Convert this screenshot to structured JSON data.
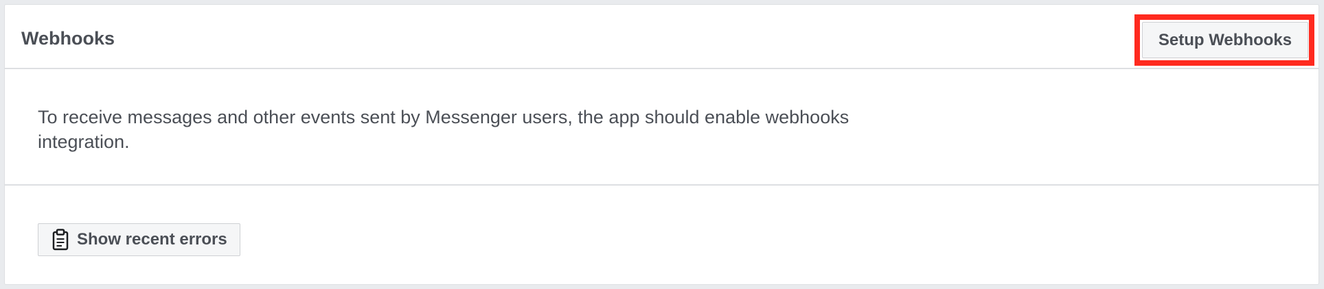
{
  "panel": {
    "title": "Webhooks",
    "setup_button_label": "Setup Webhooks",
    "highlight_color": "#ff2a1f"
  },
  "body": {
    "description": "To receive messages and other events sent by Messenger users, the app should enable webhooks integration."
  },
  "footer": {
    "errors_button_label": "Show recent errors",
    "errors_button_icon": "clipboard-icon"
  }
}
